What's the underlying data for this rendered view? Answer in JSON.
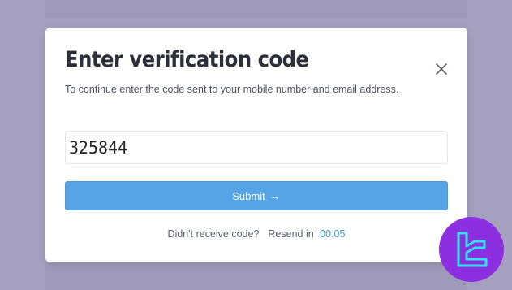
{
  "modal": {
    "title": "Enter verification code",
    "subtitle": "To continue enter the code sent to your mobile number and email address.",
    "close_icon": "close-icon",
    "code_value": "325844",
    "submit_label": "Submit",
    "submit_arrow": "→",
    "resend_text": "Didn't receive code?",
    "resend_label": "Resend in",
    "timer": "00:05"
  },
  "colors": {
    "backdrop": "#a5a0bf",
    "accent": "#56a4e6",
    "timer": "#3f9fbf",
    "logo_bg": "#8b2fe0"
  },
  "watermark_icon": "brand-logo-icon"
}
